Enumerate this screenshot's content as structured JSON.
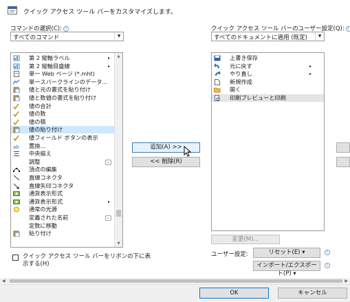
{
  "header": {
    "text": "クイック アクセス ツール バーをカスタマイズします。"
  },
  "commands": {
    "label": "コマンドの選択(C):",
    "combo_value": "すべてのコマンド",
    "items": [
      {
        "icon": "chart-icon",
        "label": "第 2 縦軸ラベル",
        "submenu": "▸"
      },
      {
        "icon": "chart-icon",
        "label": "第 2 縦軸目盛線",
        "submenu": "▸"
      },
      {
        "icon": "page-icon",
        "label": "単一 Web ページ (*.mht)"
      },
      {
        "icon": "sparkline-icon",
        "label": "単一スパークラインのデータ..."
      },
      {
        "icon": "paste-icon",
        "label": "値と元の書式を貼り付け"
      },
      {
        "icon": "paste-icon",
        "label": "値と数値の書式を貼り付け"
      },
      {
        "icon": "check-icon",
        "label": "値の合計"
      },
      {
        "icon": "check-icon",
        "label": "値の数"
      },
      {
        "icon": "check-icon",
        "label": "値の積"
      },
      {
        "icon": "paste-icon",
        "label": "値の貼り付け"
      },
      {
        "icon": "check-icon",
        "label": "値フィールド ボタンの表示"
      },
      {
        "icon": "replace-icon",
        "label": "置換..."
      },
      {
        "icon": "center-icon",
        "label": "中央揃え"
      },
      {
        "icon": "",
        "label": "調整",
        "dropdown": "⌄"
      },
      {
        "icon": "edit-points-icon",
        "label": "頂点の編集"
      },
      {
        "icon": "line-icon",
        "label": "直線コネクタ"
      },
      {
        "icon": "arrow-line-icon",
        "label": "直線矢印コネクタ"
      },
      {
        "icon": "currency-icon",
        "label": "通貨表示形式"
      },
      {
        "icon": "currency-icon",
        "label": "通貨表示形式",
        "submenu": "▸"
      },
      {
        "icon": "link-icon",
        "label": "通常の光源"
      },
      {
        "icon": "",
        "label": "定義された名前",
        "dropdown": "⌄"
      },
      {
        "icon": "",
        "label": "定数に移動"
      },
      {
        "icon": "paste-icon",
        "label": "貼り付け"
      }
    ],
    "selected_index": 9
  },
  "qat": {
    "label": "クイック アクセス ツール バーのユーザー設定(Q):",
    "combo_value": "すべてのドキュメントに適用 (既定)",
    "items": [
      {
        "icon": "save-icon",
        "label": "上書き保存"
      },
      {
        "icon": "undo-icon",
        "label": "元に戻す",
        "submenu": "▸"
      },
      {
        "icon": "redo-icon",
        "label": "やり直し",
        "submenu": "▸"
      },
      {
        "icon": "new-doc-icon",
        "label": "新規作成"
      },
      {
        "icon": "open-folder-icon",
        "label": "開く"
      },
      {
        "icon": "print-preview-icon",
        "label": "印刷プレビューと印刷"
      }
    ],
    "selected_index": 5
  },
  "buttons": {
    "add": "追加(A) >>",
    "remove": "<< 削除(R)",
    "modify": "変更(M)...",
    "reset": "リセット(E) ▾",
    "import_export": "インポート/エクスポート(P) ▾",
    "ok": "OK",
    "cancel": "キャンセル"
  },
  "user_settings_label": "ユーザー設定:",
  "show_below": {
    "line1": "クイック アクセス ツール バーをリボンの下に表",
    "line2": "示する(H)",
    "checked": false
  },
  "colors": {
    "selection": "#cde8ff",
    "accent": "#3c7fb1"
  }
}
